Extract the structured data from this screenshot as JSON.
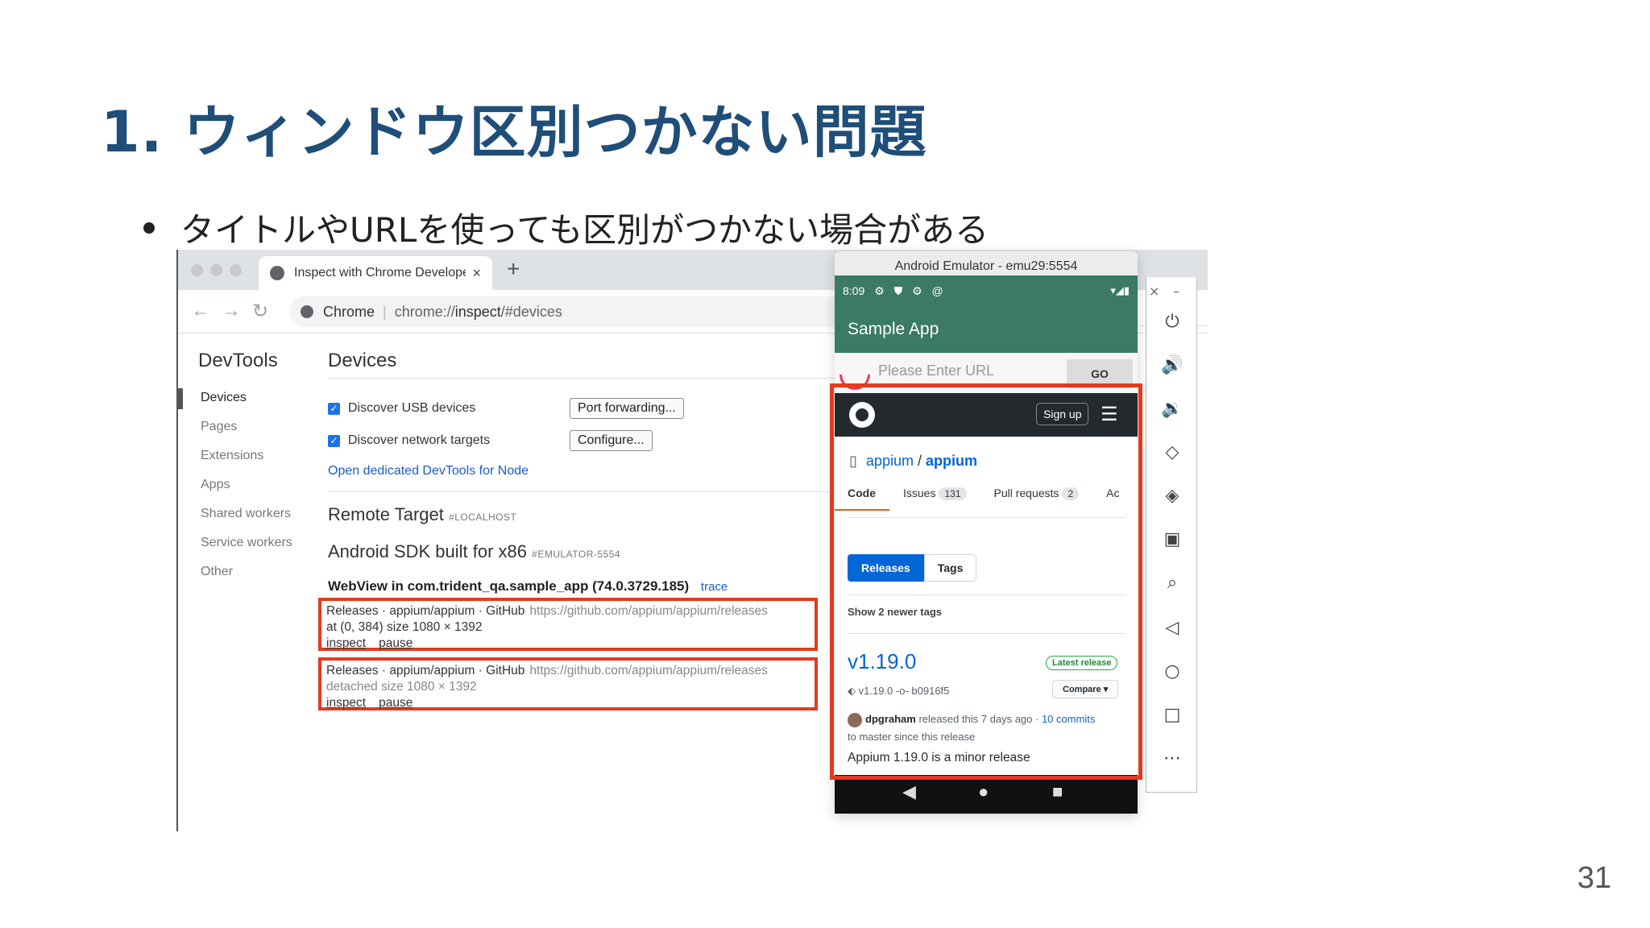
{
  "slide": {
    "title": "1. ウィンドウ区別つかない問題",
    "bullet": "タイトルやURLを使っても区別がつかない場合がある",
    "page_number": "31"
  },
  "chrome": {
    "tab_title": "Inspect with Chrome Develope",
    "tab_close": "×",
    "new_tab": "+",
    "back": "←",
    "forward": "→",
    "reload": "↻",
    "origin": "Chrome",
    "url_prefix": "chrome://",
    "url_host": "inspect",
    "url_path": "/#devices"
  },
  "devtools": {
    "heading": "DevTools",
    "nav": [
      "Devices",
      "Pages",
      "Extensions",
      "Apps",
      "Shared workers",
      "Service workers",
      "Other"
    ],
    "active_nav": "Devices"
  },
  "devices": {
    "title": "Devices",
    "discover_usb": "Discover USB devices",
    "discover_network": "Discover network targets",
    "port_forwarding": "Port forwarding...",
    "configure": "Configure...",
    "open_node": "Open dedicated DevTools for Node",
    "remote_target": "Remote Target",
    "remote_tag": "#LOCALHOST",
    "device_name": "Android SDK built for x86",
    "device_tag": "#EMULATOR-5554",
    "webview": "WebView in com.trident_qa.sample_app (74.0.3729.185)",
    "trace": "trace",
    "target1": {
      "title": "Releases · appium/appium · GitHub",
      "url": "https://github.com/appium/appium/releases",
      "info": "at (0, 384)  size 1080 × 1392",
      "inspect": "inspect",
      "pause": "pause"
    },
    "target2": {
      "title": "Releases · appium/appium · GitHub",
      "url": "https://github.com/appium/appium/releases",
      "info": "detached  size 1080 × 1392",
      "inspect": "inspect",
      "pause": "pause"
    }
  },
  "emulator": {
    "window_title": "Android Emulator - emu29:5554",
    "time": "8:09",
    "status_icons": "⚙ ⛊ ⚙ @",
    "status_right": "▾◢▮",
    "app_title": "Sample App",
    "url_placeholder": "Please Enter URL",
    "go": "GO",
    "nav_back": "◀",
    "nav_home": "●",
    "nav_recent": "■"
  },
  "github": {
    "sign_up": "Sign up",
    "menu": "☰",
    "owner": "appium",
    "slash": "/",
    "repo": "appium",
    "tabs": [
      {
        "label": "Code",
        "count": ""
      },
      {
        "label": "Issues",
        "count": "131"
      },
      {
        "label": "Pull requests",
        "count": "2"
      },
      {
        "label": "Ac",
        "count": ""
      }
    ],
    "releases_btn": "Releases",
    "tags_btn": "Tags",
    "newer_tags": "Show 2 newer tags",
    "version": "v1.19.0",
    "latest": "Latest release",
    "tag": "v1.19.0",
    "commit": "b0916f5",
    "compare": "Compare ▾",
    "author": "dpgraham",
    "released_text": " released this 7 days ago · ",
    "commits_link": "10 commits",
    "released_text2": "to master since this release",
    "release_note": "Appium 1.19.0 is a minor release"
  },
  "emulator_side": {
    "close": "×",
    "minimize": "–",
    "icons": [
      "power-icon",
      "volume-up-icon",
      "volume-down-icon",
      "rotate-left-icon",
      "rotate-right-icon",
      "camera-icon",
      "zoom-icon",
      "back-icon",
      "home-icon",
      "overview-icon",
      "more-icon"
    ]
  }
}
